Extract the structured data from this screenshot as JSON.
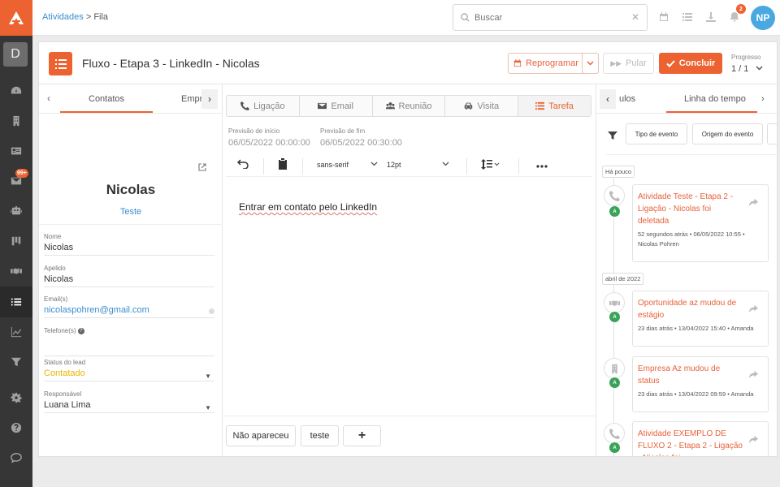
{
  "brand": {
    "logo_color": "#ec6331",
    "accent": "#ec6331",
    "link": "#3a8dcc"
  },
  "sidebar": {
    "user_initial": "D",
    "mail_badge": "99+",
    "items": [
      "dashboard-icon",
      "building-icon",
      "contact-card-icon",
      "mail-icon",
      "bot-icon",
      "kanban-icon",
      "handshake-icon",
      "tasks-icon",
      "chart-icon",
      "funnel-icon",
      "settings-icon",
      "help-icon",
      "chat-icon"
    ]
  },
  "topbar": {
    "breadcrumb_link": "Atividades",
    "breadcrumb_sep": ">",
    "breadcrumb_current": "Fila",
    "search_placeholder": "Buscar",
    "notifications_count": "2",
    "avatar_initials": "NP"
  },
  "header": {
    "title": "Fluxo - Etapa 3 - LinkedIn - Nicolas",
    "reschedule": "Reprogramar",
    "skip": "Pular",
    "finish": "Concluir",
    "progress_label": "Progresso",
    "progress_value": "1 / 1"
  },
  "left": {
    "tabs": [
      "Contatos",
      "Empr"
    ],
    "contact_name": "Nicolas",
    "contact_tag": "Teste",
    "fields": {
      "name_label": "Nome",
      "name_value": "Nicolas",
      "nickname_label": "Apelido",
      "nickname_value": "Nicolas",
      "email_label": "Email(s)",
      "email_value": "nicolaspohren@gmail.com",
      "phone_label": "Telefone(s)",
      "phone_value": "",
      "status_label": "Status do lead",
      "status_value": "Contatado",
      "owner_label": "Responsável",
      "owner_value": "Luana Lima"
    }
  },
  "middle": {
    "tabs": [
      "Ligação",
      "Email",
      "Reunião",
      "Visita",
      "Tarefa"
    ],
    "start_label": "Previsão de início",
    "start_value": "06/05/2022 00:00:00",
    "end_label": "Previsão de fim",
    "end_value": "06/05/2022 00:30:00",
    "font_name": "sans-serif",
    "font_size": "12pt",
    "editor_text": "Entrar em contato pelo LinkedIn",
    "quick_buttons": [
      "Não apareceu",
      "teste"
    ],
    "add_symbol": "+"
  },
  "right": {
    "tabs": [
      "ulos",
      "Linha do tempo"
    ],
    "filters": [
      "Tipo de evento",
      "Origem do evento"
    ],
    "groups": {
      "recent": "Há pouco",
      "april": "abril de 2022"
    },
    "events": [
      {
        "title": "Atividade Teste - Etapa 2 - Ligação - Nicolas foi deletada",
        "meta": "52 segundos atrás • 06/05/2022 10:55 • Nicolas Pohren",
        "icon": "phone-icon",
        "badge": "A"
      },
      {
        "title": "Oportunidade az mudou de estágio",
        "meta": "23 dias atrás • 13/04/2022 15:40 • Amanda",
        "icon": "handshake-icon",
        "badge": "A"
      },
      {
        "title": "Empresa Az mudou de status",
        "meta": "23 dias atrás • 13/04/2022 09:59 • Amanda",
        "icon": "building-icon",
        "badge": "A"
      },
      {
        "title": "Atividade EXEMPLO DE FLUXO 2 - Etapa 2 - Ligação - Nicolas foi",
        "meta": "",
        "icon": "phone-icon",
        "badge": "A"
      }
    ]
  }
}
